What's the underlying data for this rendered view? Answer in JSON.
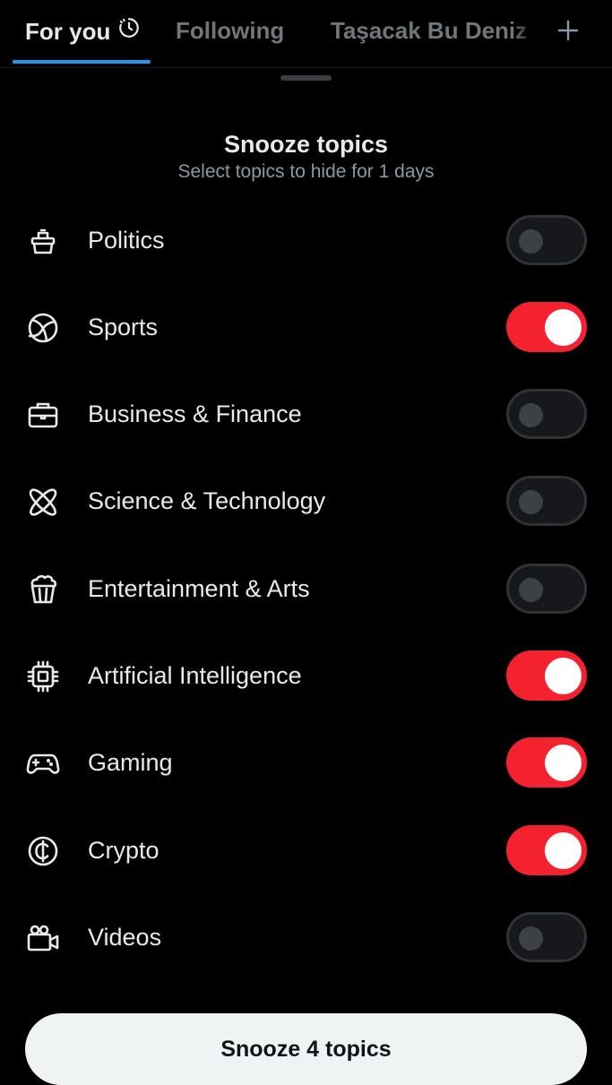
{
  "tabs": [
    {
      "label": "For you",
      "icon": "history-clock-icon",
      "active": true
    },
    {
      "label": "Following",
      "active": false
    },
    {
      "label": "Taşacak Bu Deniz",
      "active": false
    }
  ],
  "tab_add": {
    "icon": "plus-icon",
    "label": "+"
  },
  "sheet": {
    "title": "Snooze topics",
    "subtitle": "Select topics to hide for 1 days"
  },
  "topics": [
    {
      "label": "Politics",
      "icon": "ballot-box-icon",
      "enabled": false
    },
    {
      "label": "Sports",
      "icon": "ball-icon",
      "enabled": true
    },
    {
      "label": "Business & Finance",
      "icon": "briefcase-icon",
      "enabled": false
    },
    {
      "label": "Science & Technology",
      "icon": "atom-icon",
      "enabled": false
    },
    {
      "label": "Entertainment & Arts",
      "icon": "popcorn-icon",
      "enabled": false
    },
    {
      "label": "Artificial Intelligence",
      "icon": "chip-icon",
      "enabled": true
    },
    {
      "label": "Gaming",
      "icon": "gamepad-icon",
      "enabled": true
    },
    {
      "label": "Crypto",
      "icon": "crypto-coin-icon",
      "enabled": true
    },
    {
      "label": "Videos",
      "icon": "video-camera-icon",
      "enabled": false
    }
  ],
  "action": {
    "label": "Snooze 4 topics"
  },
  "colors": {
    "background": "#000000",
    "toggle_on": "#f4212e",
    "toggle_off": "#16181c",
    "tab_indicator": "#1d9bf0",
    "button_bg": "#eff3f4"
  }
}
